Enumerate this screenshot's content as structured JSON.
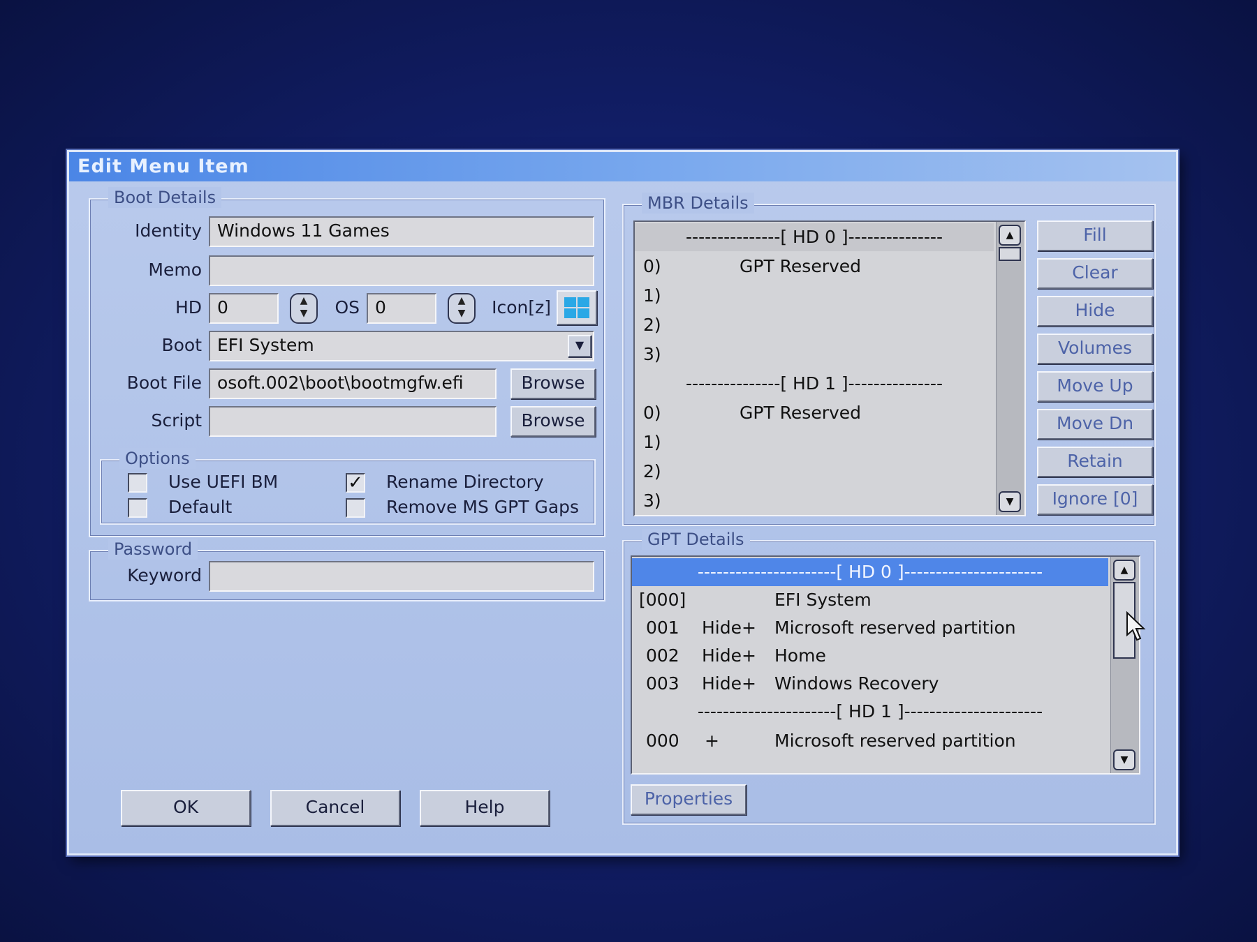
{
  "dialog": {
    "title": "Edit Menu Item"
  },
  "boot_details": {
    "legend": "Boot Details",
    "identity_label": "Identity",
    "identity_value": "Windows 11 Games",
    "memo_label": "Memo",
    "memo_value": "",
    "hd_label": "HD",
    "hd_value": "0",
    "os_label": "OS",
    "os_value": "0",
    "icon_label": "Icon[z]",
    "boot_label": "Boot",
    "boot_value": "EFI System",
    "bootfile_label": "Boot File",
    "bootfile_value": "osoft.002\\boot\\bootmgfw.efi",
    "browse_label": "Browse",
    "script_label": "Script",
    "script_value": ""
  },
  "options": {
    "legend": "Options",
    "use_uefi_bm": {
      "label": "Use UEFI BM",
      "checked": false
    },
    "default": {
      "label": "Default",
      "checked": false
    },
    "rename_directory": {
      "label": "Rename Directory",
      "checked": true
    },
    "remove_ms_gpt_gaps": {
      "label": "Remove MS GPT Gaps",
      "checked": false
    }
  },
  "password": {
    "legend": "Password",
    "keyword_label": "Keyword",
    "keyword_value": ""
  },
  "buttons": {
    "ok": "OK",
    "cancel": "Cancel",
    "help": "Help",
    "properties": "Properties"
  },
  "mbr": {
    "legend": "MBR Details",
    "hd0_sep": "---------------[ HD 0 ]---------------",
    "hd1_sep": "---------------[ HD 1 ]---------------",
    "hd0_rows": [
      {
        "idx": "0)",
        "text": "GPT Reserved"
      },
      {
        "idx": "1)",
        "text": ""
      },
      {
        "idx": "2)",
        "text": ""
      },
      {
        "idx": "3)",
        "text": ""
      }
    ],
    "hd1_rows": [
      {
        "idx": "0)",
        "text": "GPT Reserved"
      },
      {
        "idx": "1)",
        "text": ""
      },
      {
        "idx": "2)",
        "text": ""
      },
      {
        "idx": "3)",
        "text": ""
      }
    ],
    "side_buttons": [
      "Fill",
      "Clear",
      "Hide",
      "Volumes",
      "Move Up",
      "Move Dn",
      "Retain",
      "Ignore [0]"
    ]
  },
  "gpt": {
    "legend": "GPT Details",
    "hd0_sep": "----------------------[ HD 0 ]----------------------",
    "hd1_sep": "----------------------[ HD 1 ]----------------------",
    "rows": [
      {
        "num": "[000]",
        "flag": "",
        "name": "EFI System"
      },
      {
        "num": "001",
        "flag": "Hide+",
        "name": "Microsoft reserved partition"
      },
      {
        "num": "002",
        "flag": "Hide+",
        "name": "Home"
      },
      {
        "num": "003",
        "flag": "Hide+",
        "name": "Windows Recovery"
      }
    ],
    "hd1_rows": [
      {
        "num": "000",
        "flag": "+",
        "name": "Microsoft reserved partition"
      }
    ]
  },
  "colors": {
    "selection": "#4f86e8",
    "dialog_bg": "#b3c5ea",
    "titlebar": "#4b86e6"
  }
}
